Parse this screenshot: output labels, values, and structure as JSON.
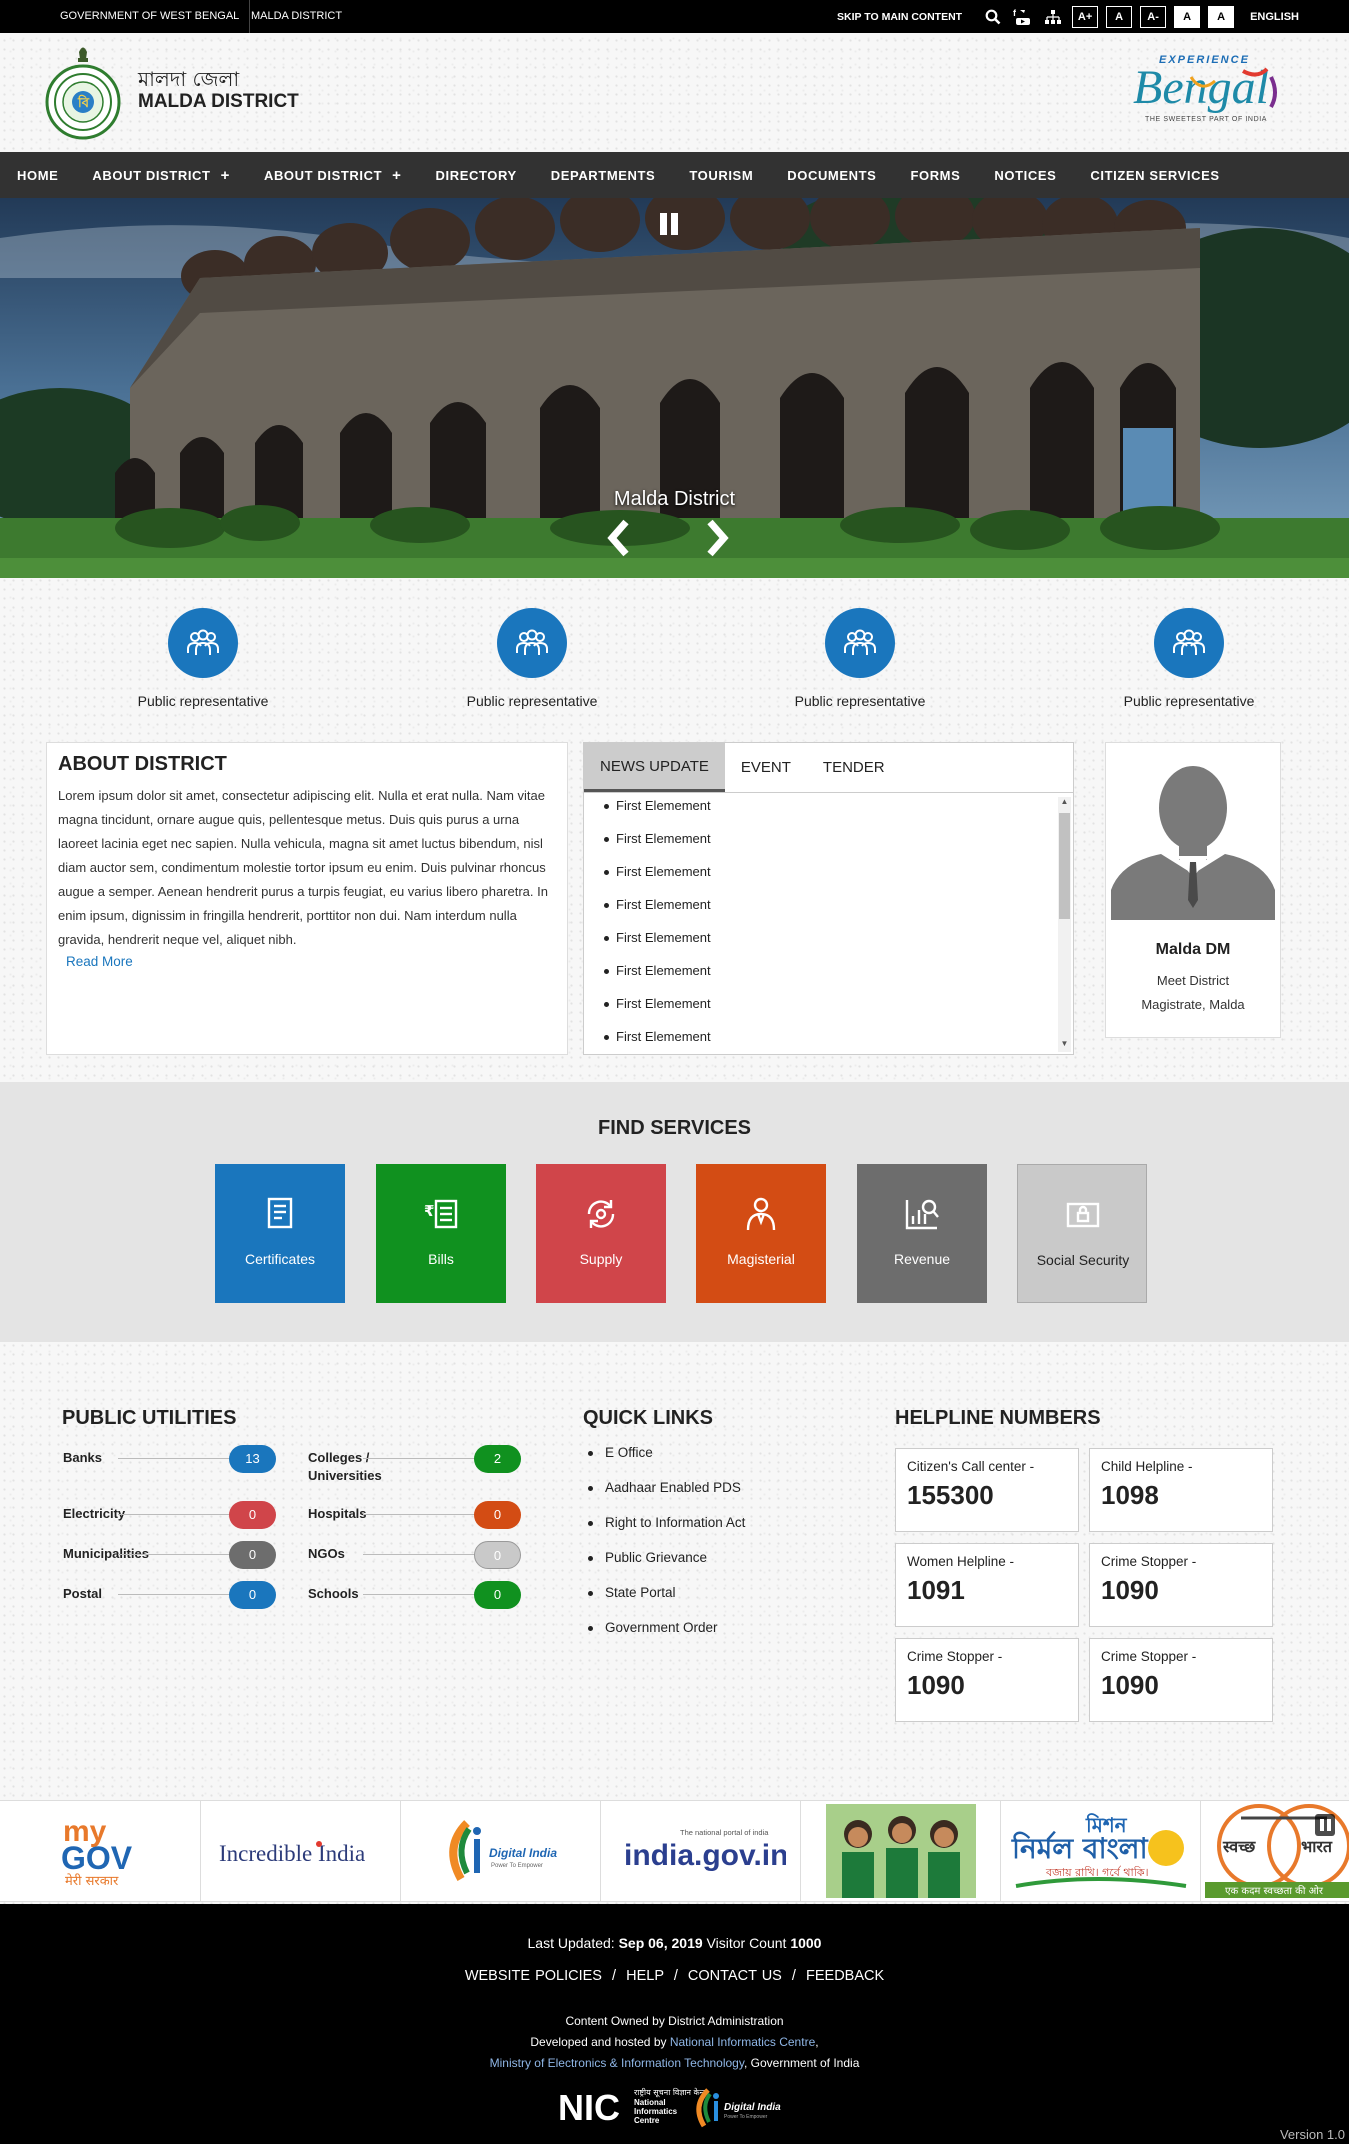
{
  "topbar": {
    "gov_link": "GOVERNMENT OF WEST BENGAL",
    "district_link": "MALDA DISTRICT",
    "skip": "SKIP TO MAIN CONTENT",
    "font_sizes": [
      "A+",
      "A",
      "A-",
      "A",
      "A"
    ],
    "language": "ENGLISH"
  },
  "header": {
    "title_bn": "মালদা জেলা",
    "title_en": "MALDA DISTRICT",
    "brand_top": "EXPERIENCE",
    "brand_main": "Bengal",
    "brand_tagline": "THE SWEETEST PART OF INDIA"
  },
  "nav": {
    "items": [
      {
        "label": "HOME",
        "submenu": false
      },
      {
        "label": "ABOUT DISTRICT",
        "submenu": true
      },
      {
        "label": "ABOUT DISTRICT",
        "submenu": true
      },
      {
        "label": "DIRECTORY",
        "submenu": false
      },
      {
        "label": "DEPARTMENTS",
        "submenu": false
      },
      {
        "label": "TOURISM",
        "submenu": false
      },
      {
        "label": "DOCUMENTS",
        "submenu": false
      },
      {
        "label": "FORMS",
        "submenu": false
      },
      {
        "label": "NOTICES",
        "submenu": false
      },
      {
        "label": "CITIZEN SERVICES",
        "submenu": false
      }
    ]
  },
  "hero": {
    "caption": "Malda District"
  },
  "representatives": [
    {
      "label": "Public representative"
    },
    {
      "label": "Public representative"
    },
    {
      "label": "Public representative"
    },
    {
      "label": "Public representative"
    }
  ],
  "about": {
    "title": "ABOUT DISTRICT",
    "text": "Lorem ipsum dolor sit amet, consectetur adipiscing elit. Nulla et erat nulla. Nam vitae magna tincidunt, ornare augue quis, pellentesque metus. Duis quis purus a urna laoreet lacinia eget nec sapien. Nulla vehicula, magna sit amet luctus bibendum, nisl diam auctor sem, condimentum molestie tortor ipsum eu enim. Duis pulvinar rhoncus augue a semper. Aenean hendrerit purus a turpis feugiat, eu varius libero pharetra. In enim ipsum, dignissim in fringilla hendrerit, porttitor non dui. Nam interdum nulla gravida, hendrerit neque vel, aliquet nibh.",
    "read_more": "Read More"
  },
  "news": {
    "tabs": [
      "NEWS UPDATE",
      "EVENT",
      "TENDER"
    ],
    "active_tab": 0,
    "items": [
      "First Elemement",
      "First Elemement",
      "First Elemement",
      "First Elemement",
      "First Elemement",
      "First Elemement",
      "First Elemement",
      "First Elemement"
    ]
  },
  "dm": {
    "name": "Malda DM",
    "desc": "Meet District Magistrate, Malda"
  },
  "services": {
    "title": "FIND SERVICES",
    "items": [
      {
        "label": "Certificates",
        "color": "#1a76bd",
        "icon": "certificate-icon"
      },
      {
        "label": "Bills",
        "color": "#10911f",
        "icon": "bill-icon"
      },
      {
        "label": "Supply",
        "color": "#d0454a",
        "icon": "supply-icon"
      },
      {
        "label": "Magisterial",
        "color": "#d34c14",
        "icon": "magistrate-icon"
      },
      {
        "label": "Revenue",
        "color": "#6d6d6d",
        "icon": "revenue-icon"
      },
      {
        "label": "Social Security",
        "color": "#c9c9c9",
        "icon": "security-icon"
      }
    ]
  },
  "utilities": {
    "title": "PUBLIC UTILITIES",
    "left": [
      {
        "name": "Banks",
        "count": "13",
        "color": "#1a76bd"
      },
      {
        "name": "Electricity",
        "count": "0",
        "color": "#d0454a"
      },
      {
        "name": "Municipalities",
        "count": "0",
        "color": "#6d6d6d"
      },
      {
        "name": "Postal",
        "count": "0",
        "color": "#1a76bd"
      }
    ],
    "right": [
      {
        "name": "Colleges / Universities",
        "count": "2",
        "color": "#10911f"
      },
      {
        "name": "Hospitals",
        "count": "0",
        "color": "#d34c14"
      },
      {
        "name": "NGOs",
        "count": "0",
        "color": "#c9c9c9"
      },
      {
        "name": "Schools",
        "count": "0",
        "color": "#10911f"
      }
    ]
  },
  "quick_links": {
    "title": "QUICK LINKS",
    "items": [
      "E Office",
      "Aadhaar Enabled PDS",
      "Right to Information Act",
      "Public Grievance",
      "State Portal",
      "Government Order"
    ]
  },
  "helpline": {
    "title": "HELPLINE NUMBERS",
    "items": [
      {
        "label": "Citizen's Call center -",
        "number": "155300"
      },
      {
        "label": "Child Helpline -",
        "number": "1098"
      },
      {
        "label": "Women Helpline -",
        "number": "1091"
      },
      {
        "label": "Crime Stopper -",
        "number": "1090"
      },
      {
        "label": "Crime Stopper -",
        "number": "1090"
      },
      {
        "label": "Crime Stopper -",
        "number": "1090"
      }
    ]
  },
  "partners": {
    "mygov_top": "my",
    "mygov_bottom": "GOV",
    "mygov_sub": "मेरी सरकार",
    "incredible": "Incredible India",
    "digital_india": "Digital India",
    "digital_india_sub": "Power To Empower",
    "india_gov": "india.gov.in",
    "india_gov_sub": "The national portal of india",
    "nirmal": "নির্মল বাংলা",
    "mission": "মিশন",
    "nirmal_sub": "বজায় রাখি। গর্বে থাকি।",
    "swachh": "स्वच्छ",
    "bharat": "भारत",
    "swachh_sub": "एक कदम स्वच्छता की ओर"
  },
  "footer": {
    "last_updated_label": "Last Updated:",
    "last_updated_date": "Sep 06, 2019",
    "visitor_label": "Visitor Count",
    "visitor_count": "1000",
    "links": [
      "WEBSITE POLICIES",
      "HELP",
      "CONTACT US",
      "FEEDBACK"
    ],
    "owned": "Content Owned by District Administration",
    "developed_prefix": "Developed and hosted by",
    "nic": "National Informatics Centre",
    "ministry": "Ministry of Electronics & Information Technology",
    "govt": "Government of India",
    "nic_logo": "NIC",
    "nic_hindi": "राष्ट्रीय सूचना विज्ञान केन्द्र",
    "nic_name_1": "National",
    "nic_name_2": "Informatics",
    "nic_name_3": "Centre",
    "digital_india": "Digital India",
    "digital_india_sub": "Power To Empower",
    "version": "Version 1.0"
  }
}
